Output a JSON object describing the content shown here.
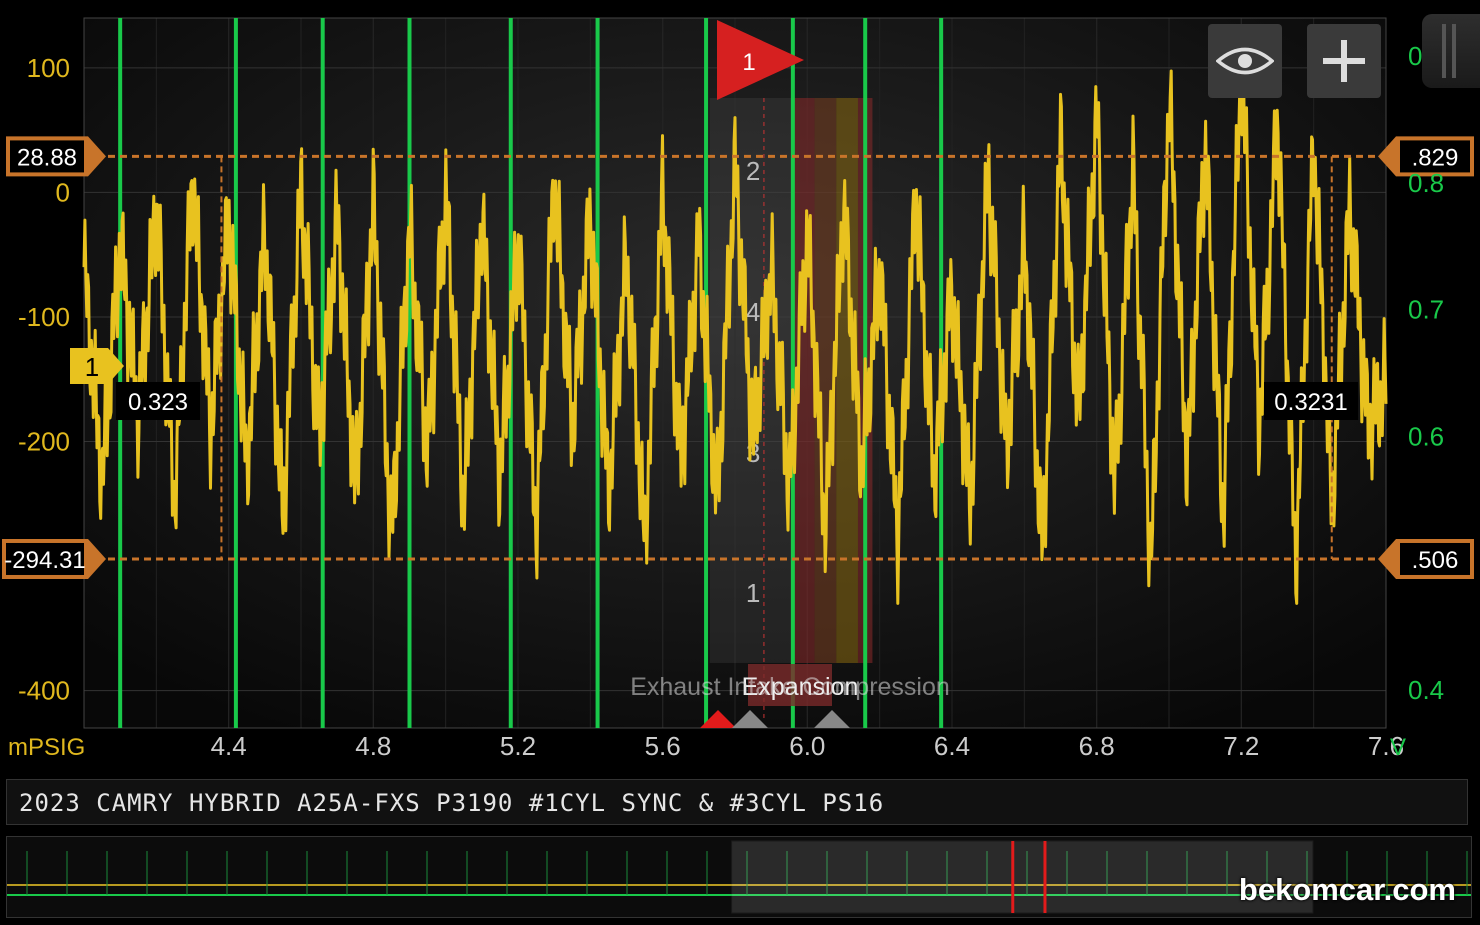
{
  "chart_data": {
    "type": "line",
    "title": "2023 CAMRY HYBRID A25A-FXS P3190 #1CYL SYNC & #3CYL PS16",
    "xlim": [
      4.0,
      7.6
    ],
    "x_ticks": [
      "4.4",
      "4.8",
      "5.2",
      "5.6",
      "6.0",
      "6.4",
      "6.8",
      "7.2",
      "7.6"
    ],
    "y_left": {
      "unit": "mPSIG",
      "ticks": [
        "100",
        "0",
        "-100",
        "-200",
        "-400"
      ],
      "range": [
        -430,
        140
      ]
    },
    "y_right": {
      "unit": "V",
      "ticks": [
        "0.9",
        "0.8",
        "0.7",
        "0.6",
        "0.4"
      ],
      "range": [
        0.37,
        0.93
      ]
    },
    "cursors": {
      "left_top": "28.88",
      "left_bottom": "-294.31",
      "right_top": ".829",
      "right_bottom": ".506",
      "time_left": "0.323",
      "time_right": "0.3231"
    },
    "pressure_trace": {
      "name": "mPSIG",
      "color": "#e8c21f",
      "x": [
        4.0,
        4.05,
        4.1,
        4.15,
        4.2,
        4.25,
        4.3,
        4.35,
        4.4,
        4.45,
        4.5,
        4.55,
        4.6,
        4.65,
        4.7,
        4.75,
        4.8,
        4.85,
        4.9,
        4.95,
        5.0,
        5.05,
        5.1,
        5.15,
        5.2,
        5.25,
        5.3,
        5.35,
        5.4,
        5.45,
        5.5,
        5.55,
        5.6,
        5.65,
        5.7,
        5.75,
        5.8,
        5.85,
        5.9,
        5.95,
        6.0,
        6.05,
        6.1,
        6.15,
        6.2,
        6.25,
        6.3,
        6.35,
        6.4,
        6.45,
        6.5,
        6.55,
        6.6,
        6.65,
        6.7,
        6.75,
        6.8,
        6.85,
        6.9,
        6.95,
        7.0,
        7.05,
        7.1,
        7.15,
        7.2,
        7.25,
        7.3,
        7.35,
        7.4,
        7.45,
        7.5,
        7.55,
        7.6
      ],
      "y": [
        -60,
        -230,
        -40,
        -180,
        -10,
        -250,
        10,
        -190,
        -20,
        -220,
        -30,
        -260,
        5,
        -200,
        -20,
        -240,
        -10,
        -280,
        -30,
        -210,
        0,
        -250,
        -20,
        -230,
        -40,
        -270,
        10,
        -190,
        -20,
        -240,
        -50,
        -280,
        0,
        -220,
        -40,
        -250,
        20,
        -200,
        -60,
        -240,
        -30,
        -270,
        -10,
        -220,
        -60,
        -280,
        0,
        -230,
        -80,
        -250,
        20,
        -210,
        -40,
        -290,
        40,
        -180,
        60,
        -240,
        20,
        -300,
        80,
        -220,
        40,
        -260,
        100,
        -190,
        60,
        -300,
        40,
        -250,
        -10,
        -190,
        -150
      ]
    },
    "sync_markers": {
      "name": "V",
      "color": "#19c94a",
      "x": [
        4.1,
        4.42,
        4.66,
        4.9,
        5.18,
        5.42,
        5.72,
        5.96,
        6.16,
        6.37
      ]
    },
    "annotations": {
      "cursor1_label": "1",
      "trigger_flag": "1",
      "cylinder_labels": [
        "2",
        "4",
        "3",
        "1"
      ],
      "stroke_label": "Expansion",
      "stroke_overlap": "Exhaust Intake Compression"
    }
  },
  "title_bar": {
    "text": "2023 CAMRY HYBRID A25A-FXS P3190 #1CYL SYNC & #3CYL PS16"
  },
  "watermark": {
    "text": "bekomcar.com"
  },
  "buttons": {
    "eye": "eye-icon",
    "plus": "plus-icon"
  },
  "overview": {
    "window_start_fraction": 0.495,
    "window_end_fraction": 0.892,
    "red_markers_fraction": [
      0.687,
      0.709
    ]
  }
}
